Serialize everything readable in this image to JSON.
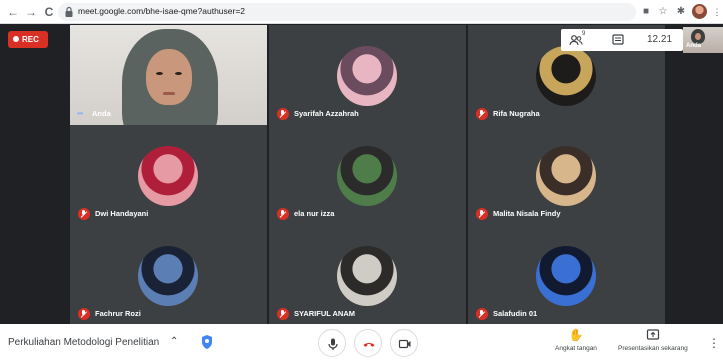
{
  "browser": {
    "url": "meet.google.com/bhe-isae-qme?authuser=2",
    "back_glyph": "←",
    "forward_glyph": "→",
    "reload_glyph": "C"
  },
  "meet": {
    "rec_label": "REC",
    "participant_badge": "9",
    "clock": "12.21",
    "self_thumb_label": "Anda",
    "tiles": [
      {
        "name": "Anda",
        "muted": false,
        "kind": "video"
      },
      {
        "name": "Syarifah Azzahrah",
        "muted": true,
        "kind": "avatar",
        "avatar_colors": [
          "#e7b6c2",
          "#6b4b5e"
        ]
      },
      {
        "name": "Rifa Nugraha",
        "muted": true,
        "kind": "avatar",
        "avatar_colors": [
          "#1e1c1a",
          "#c7a55a"
        ]
      },
      {
        "name": "Dwi Handayani",
        "muted": true,
        "kind": "avatar",
        "avatar_colors": [
          "#e59aa4",
          "#b01f3a"
        ]
      },
      {
        "name": "ela nur izza",
        "muted": true,
        "kind": "avatar",
        "avatar_colors": [
          "#4f7d4a",
          "#2b2b2b"
        ]
      },
      {
        "name": "Malita Nisala Findy",
        "muted": true,
        "kind": "avatar",
        "avatar_colors": [
          "#d8b68c",
          "#3a2e28"
        ]
      },
      {
        "name": "Fachrur Rozi",
        "muted": true,
        "kind": "avatar",
        "avatar_colors": [
          "#5b7fb5",
          "#1a2335"
        ]
      },
      {
        "name": "SYARIFUL ANAM",
        "muted": true,
        "kind": "avatar",
        "avatar_colors": [
          "#cfcbc5",
          "#2d2b29"
        ]
      },
      {
        "name": "Salafudin 01",
        "muted": true,
        "kind": "avatar",
        "avatar_colors": [
          "#3a6fd4",
          "#111a30"
        ]
      }
    ]
  },
  "bottom": {
    "meeting_title": "Perkuliahan Metodologi Penelitian",
    "raise_hand_label": "Angkat tangan",
    "present_label": "Presentasikan sekarang"
  },
  "colors": {
    "accent_red": "#d93025",
    "stage_bg": "#202124",
    "tile_bg": "#3c4043"
  },
  "icons": [
    "back-icon",
    "forward-icon",
    "reload-icon",
    "lock-icon",
    "people-icon",
    "chat-icon",
    "mic-icon",
    "hangup-icon",
    "camera-icon",
    "raise-hand-icon",
    "present-icon",
    "shield-icon",
    "more-icon"
  ]
}
